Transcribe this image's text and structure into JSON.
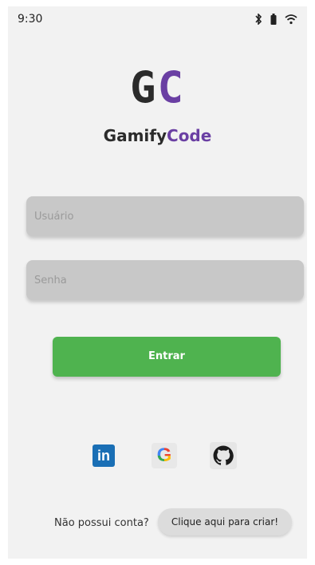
{
  "status": {
    "time": "9:30"
  },
  "logo": {
    "letter1": "G",
    "letter2": "C"
  },
  "brand": {
    "part1": "Gamify",
    "part2": "Code"
  },
  "form": {
    "username_placeholder": "Usuário",
    "password_placeholder": "Senha",
    "login_label": "Entrar"
  },
  "social": {
    "linkedin_text": "in",
    "google_text": "G",
    "icons": [
      "linkedin-icon",
      "google-icon",
      "github-icon"
    ]
  },
  "signup": {
    "prompt": "Não possui conta?",
    "button_label": "Clique aqui para criar!"
  },
  "colors": {
    "accent_purple": "#6a3fa3",
    "primary_green": "#4fb34f",
    "field_gray": "#c8c8c8",
    "linkedin_blue": "#1a6fb5"
  }
}
